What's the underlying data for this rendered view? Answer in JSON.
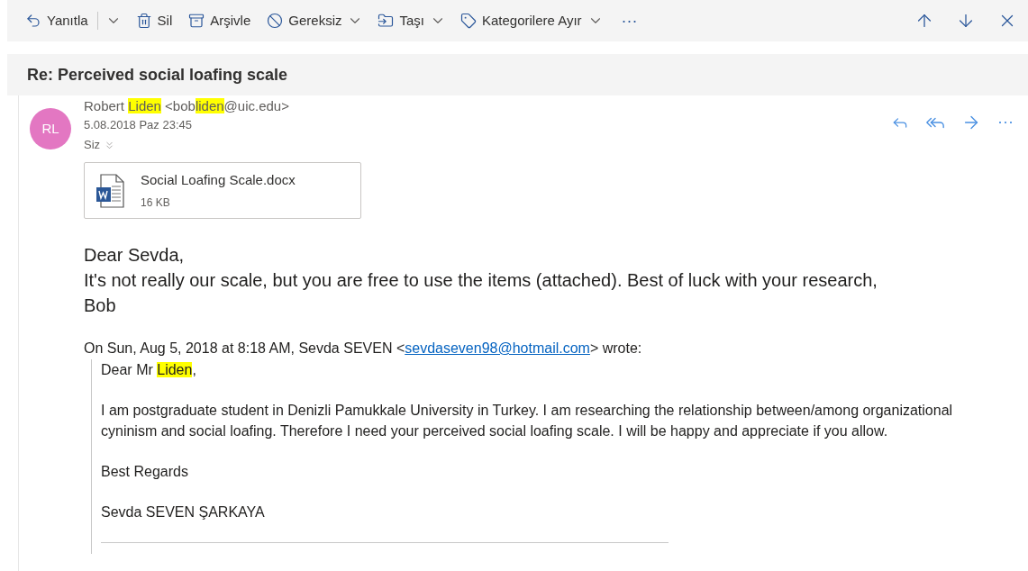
{
  "toolbar": {
    "items": [
      {
        "label": "Yanıtla",
        "dropdown": true
      },
      {
        "label": "Sil",
        "dropdown": false
      },
      {
        "label": "Arşivle",
        "dropdown": false
      },
      {
        "label": "Gereksiz",
        "dropdown": true
      },
      {
        "label": "Taşı",
        "dropdown": true
      },
      {
        "label": "Kategorilere Ayır",
        "dropdown": true
      }
    ],
    "more": "···"
  },
  "subject": "Re: Perceived social loafing scale",
  "message": {
    "avatar": {
      "initials": "RL",
      "color": "#e377c2"
    },
    "sender": [
      {
        "text": "Robert ",
        "highlighted": false
      },
      {
        "text": "Liden",
        "highlighted": true
      },
      {
        "text": " <bob",
        "highlighted": false
      },
      {
        "text": "liden",
        "highlighted": true
      },
      {
        "text": "@uic.edu>",
        "highlighted": false
      }
    ],
    "date": "5.08.2018 Paz 23:45",
    "to": "Siz",
    "more": "···",
    "attachment": {
      "name": "Social Loafing Scale.docx",
      "size": "16 KB"
    },
    "body": [
      "Dear Sevda,",
      "It's not really our scale, but you are free to use the items (attached). Best of luck with your research,",
      "Bob"
    ],
    "quote_header": {
      "before": "On Sun, Aug 5, 2018 at 8:18 AM, Sevda SEVEN <",
      "link": "sevdaseven98@hotmail.com",
      "after": "> wrote:"
    },
    "quote": [
      [
        {
          "text": "Dear Mr ",
          "highlighted": false
        },
        {
          "text": "Liden",
          "highlighted": true
        },
        {
          "text": ",",
          "highlighted": false
        }
      ],
      [
        {
          "text": "I am postgraduate student in Denizli Pamukkale University in Turkey. I am researching the relationship between/among organizational cyninism and social loafing. Therefore I need your perceived social loafing scale. I will be happy and appreciate if you allow.",
          "highlighted": false
        }
      ],
      [
        {
          "text": "Best Regards",
          "highlighted": false
        }
      ],
      [
        {
          "text": "Sevda SEVEN ŞARKAYA",
          "highlighted": false
        }
      ]
    ]
  }
}
